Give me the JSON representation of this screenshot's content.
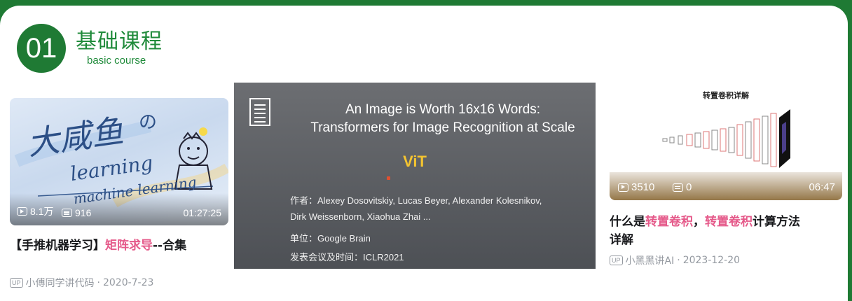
{
  "section": {
    "number": "01",
    "title": "基础课程",
    "subtitle": "basic course"
  },
  "cards": [
    {
      "views": "8.1万",
      "danmaku": "916",
      "duration": "01:27:25",
      "title_prefix": "【手推机器学习】",
      "title_highlight": "矩阵求导",
      "title_suffix": "--合集",
      "uploader_badge": "UP",
      "uploader": "小傅同学讲代码",
      "date": "2020-7-23",
      "thumb_text": {
        "line1": "大咸鱼",
        "line1b": "の",
        "line2": "learning",
        "line3": "machine learning"
      }
    },
    {
      "slide_title_line1": "An Image is Worth 16x16 Words:",
      "slide_title_line2": "Transformers for Image Recognition at Scale",
      "slide_highlight": "ViT",
      "authors_line1": "作者：Alexey Dosovitskiy, Lucas Beyer, Alexander Kolesnikov,",
      "authors_line2": "Dirk Weissenborn, Xiaohua Zhai ...",
      "affiliation": "单位：Google Brain",
      "venue": "发表会议及时间：ICLR2021"
    },
    {
      "diagram_title": "转置卷积详解",
      "views": "3510",
      "danmaku": "0",
      "duration": "06:47",
      "title_a": "什么是",
      "title_hl1": "转置卷积",
      "title_b": "，",
      "title_hl2": "转置卷积",
      "title_c": "计算方法",
      "title_line2": "详解",
      "uploader_badge": "UP",
      "uploader": "小黑黑讲AI",
      "date": "2023-12-20"
    }
  ],
  "colors": {
    "brand_green": "#1f7a34",
    "highlight_pink": "#e55a8a",
    "vit_yellow": "#f4c430"
  }
}
